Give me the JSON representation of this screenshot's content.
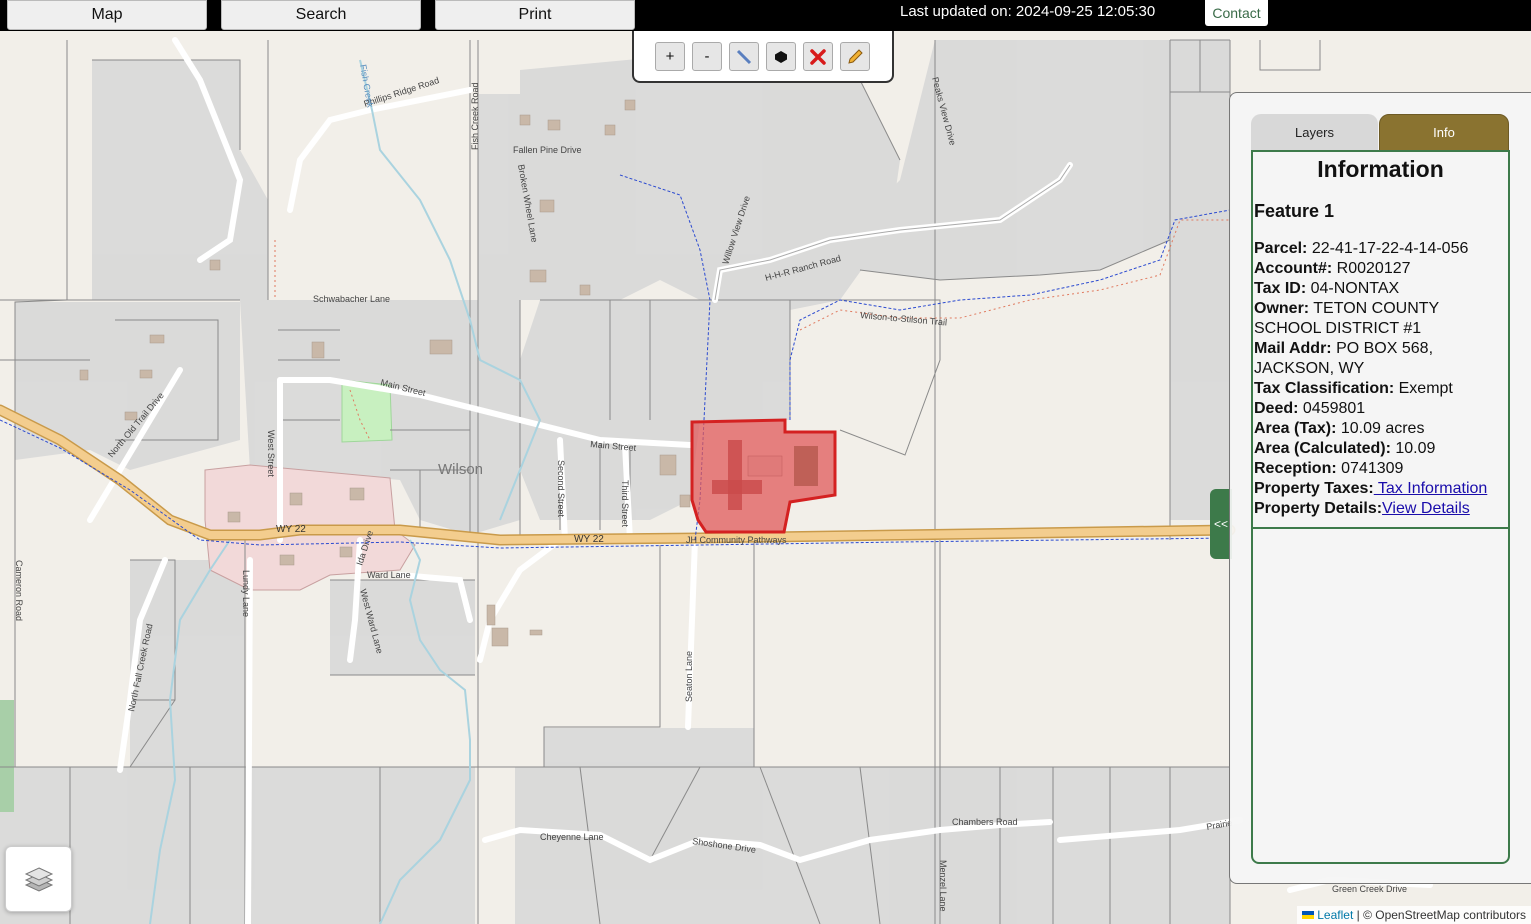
{
  "header": {
    "nav": [
      {
        "label": "Map"
      },
      {
        "label": "Search"
      },
      {
        "label": "Print"
      }
    ],
    "last_updated": "Last updated on: 2024-09-25 12:05:30",
    "contact_label": "Contact"
  },
  "draw_toolbar": {
    "zoom_in": "+",
    "zoom_out": "-",
    "tools": [
      "zoom-in",
      "zoom-out",
      "measure-line",
      "polygon",
      "delete",
      "edit"
    ]
  },
  "map": {
    "town_label": "Wilson",
    "highway_label": "WY 22",
    "highway_label_2": "WY 22",
    "streets": [
      "Phillips Ridge Road",
      "Fish Creek Road",
      "Fallen Pine Drive",
      "Broken Wheel Lane",
      "Willow View Drive",
      "Peaks View Drive",
      "H-H-R Ranch Road",
      "Wilson-to-Stilson Trail",
      "JH Community Pathways",
      "Schwabacher Lane",
      "Main Street",
      "Second Street",
      "Third Street",
      "West Street",
      "North Old Trail Drive",
      "Ida Drive",
      "Ward Lane",
      "West Ward Lane",
      "Lundy Lane",
      "Cameron Road",
      "North Fall Creek Road",
      "Seaton Lane",
      "Cheyenne Lane",
      "Shoshone Drive",
      "Chambers Road",
      "Menzel Lane",
      "Green Creek Drive",
      "Fish Creek",
      "Prairie"
    ],
    "colors": {
      "background": "#f2efe9",
      "parcel_fill": "#d9d9d9",
      "parcel_stroke": "#777777",
      "selected_fill": "#e05a5a",
      "selected_stroke": "#d42121",
      "highway": "#f3cd8e",
      "park": "#c8f0c0",
      "commercial": "#f2d9d9"
    }
  },
  "attribution": {
    "leaflet": "Leaflet",
    "osm": "| © OpenStreetMap contributors"
  },
  "panel": {
    "toggle_label": "<<",
    "tabs": [
      {
        "label": "Layers",
        "active": false
      },
      {
        "label": "Info",
        "active": true
      }
    ],
    "info_title": "Information",
    "feature_title": "Feature 1",
    "fields": [
      {
        "label": "Parcel:",
        "value": " 22-41-17-22-4-14-056"
      },
      {
        "label": "Account#:",
        "value": " R0020127"
      },
      {
        "label": "Tax ID:",
        "value": " 04-NONTAX"
      },
      {
        "label": "Owner:",
        "value": " TETON COUNTY SCHOOL DISTRICT #1"
      },
      {
        "label": "Mail Addr:",
        "value": " PO BOX 568, JACKSON, WY"
      },
      {
        "label": "Tax Classification:",
        "value": " Exempt"
      },
      {
        "label": "Deed:",
        "value": " 0459801"
      },
      {
        "label": "Area (Tax):",
        "value": " 10.09 acres"
      },
      {
        "label": "Area (Calculated):",
        "value": " 10.09"
      },
      {
        "label": "Reception:",
        "value": " 0741309"
      }
    ],
    "property_taxes_label": "Property Taxes:",
    "property_taxes_link": " Tax Information",
    "property_details_label": "Property Details:",
    "property_details_link": "View Details"
  }
}
